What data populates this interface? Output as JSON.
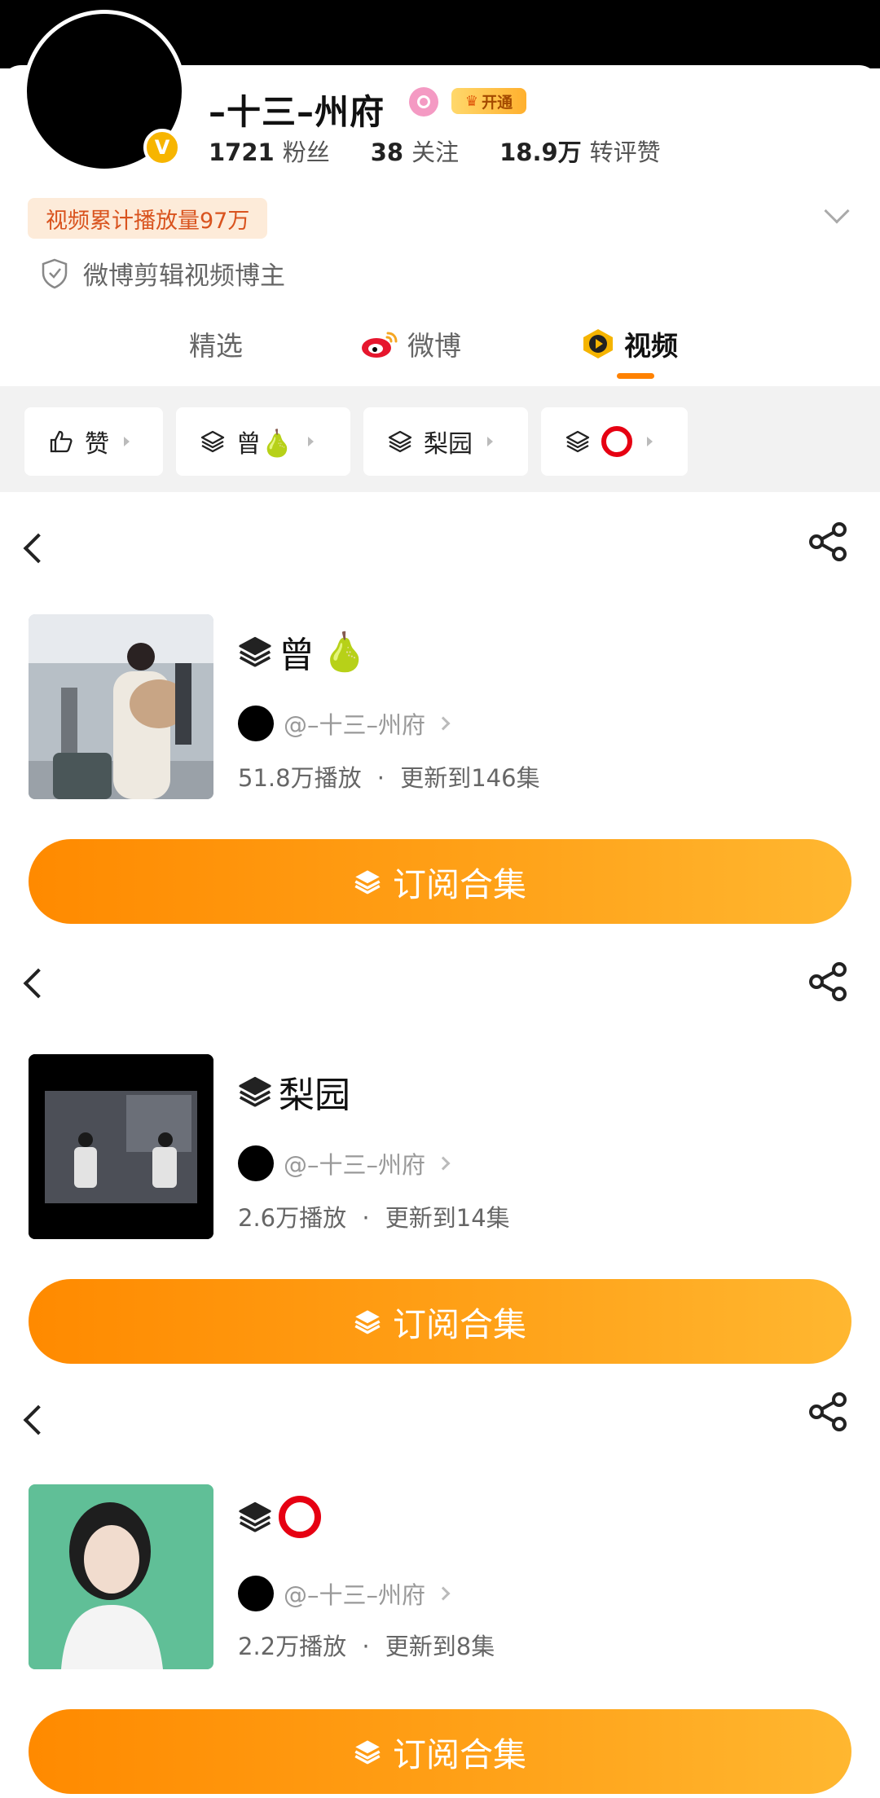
{
  "profile": {
    "name": "–十三–州府",
    "open_label": "开通",
    "stats": [
      {
        "num": "1721",
        "label": "粉丝"
      },
      {
        "num": "38",
        "label": "关注"
      },
      {
        "num": "18.9万",
        "label": "转评赞"
      }
    ],
    "play_tag": "视频累计播放量97万",
    "creator_label": "微博剪辑视频博主"
  },
  "tabs": [
    {
      "label": "精选",
      "icon": "none"
    },
    {
      "label": "微博",
      "icon": "weibo-logo-icon"
    },
    {
      "label": "视频",
      "icon": "video-play-icon",
      "active": true
    }
  ],
  "chips": [
    {
      "label": "赞",
      "icon": "thumbs-up-icon"
    },
    {
      "label": "曾",
      "icon": "stack-icon",
      "emoji": "🍐"
    },
    {
      "label": "梨园",
      "icon": "stack-icon"
    },
    {
      "label": "",
      "icon": "stack-icon",
      "symbol": "red-ring"
    }
  ],
  "collections": [
    {
      "title": "曾",
      "emoji": "🍐",
      "author": "@–十三–州府",
      "plays": "51.8万播放",
      "sep": "·",
      "update": "更新到146集",
      "button": "订阅合集"
    },
    {
      "title": "梨园",
      "author": "@–十三–州府",
      "plays": "2.6万播放",
      "sep": "·",
      "update": "更新到14集",
      "button": "订阅合集"
    },
    {
      "title": "",
      "symbol": "red-ring",
      "author": "@–十三–州府",
      "plays": "2.2万播放",
      "sep": "·",
      "update": "更新到8集",
      "button": "订阅合集"
    }
  ],
  "colors": {
    "accent": "#ff8200",
    "badge": "#f7b500",
    "button_start": "#ff8a00",
    "button_end": "#ffb730",
    "tag_bg": "#fdebd9",
    "tag_text": "#d9531e"
  }
}
